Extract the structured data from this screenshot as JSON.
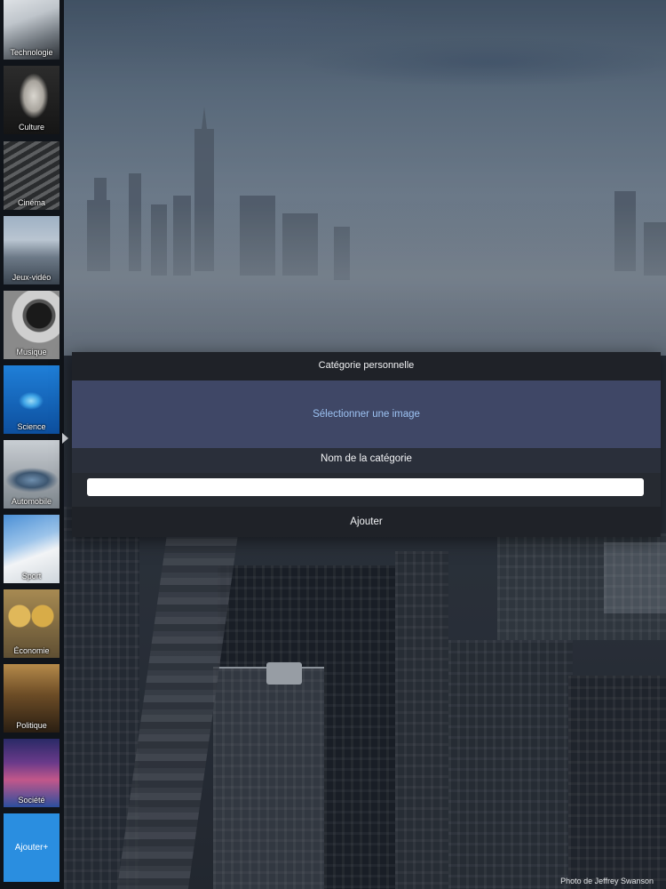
{
  "sidebar": {
    "categories": [
      {
        "label": "Technologie"
      },
      {
        "label": "Culture"
      },
      {
        "label": "Cinéma"
      },
      {
        "label": "Jeux-vidéo"
      },
      {
        "label": "Musique"
      },
      {
        "label": "Science"
      },
      {
        "label": "Automobile"
      },
      {
        "label": "Sport"
      },
      {
        "label": "Économie"
      },
      {
        "label": "Politique"
      },
      {
        "label": "Société"
      }
    ],
    "add_label": "Ajouter+"
  },
  "modal": {
    "title": "Catégorie personnelle",
    "select_image": "Sélectionner une image",
    "name_label": "Nom de la catégorie",
    "name_value": "",
    "submit_label": "Ajouter"
  },
  "background": {
    "credit": "Photo de Jeffrey Swanson"
  },
  "colors": {
    "accent": "#2a8ee0",
    "link": "#9cc2f2"
  }
}
